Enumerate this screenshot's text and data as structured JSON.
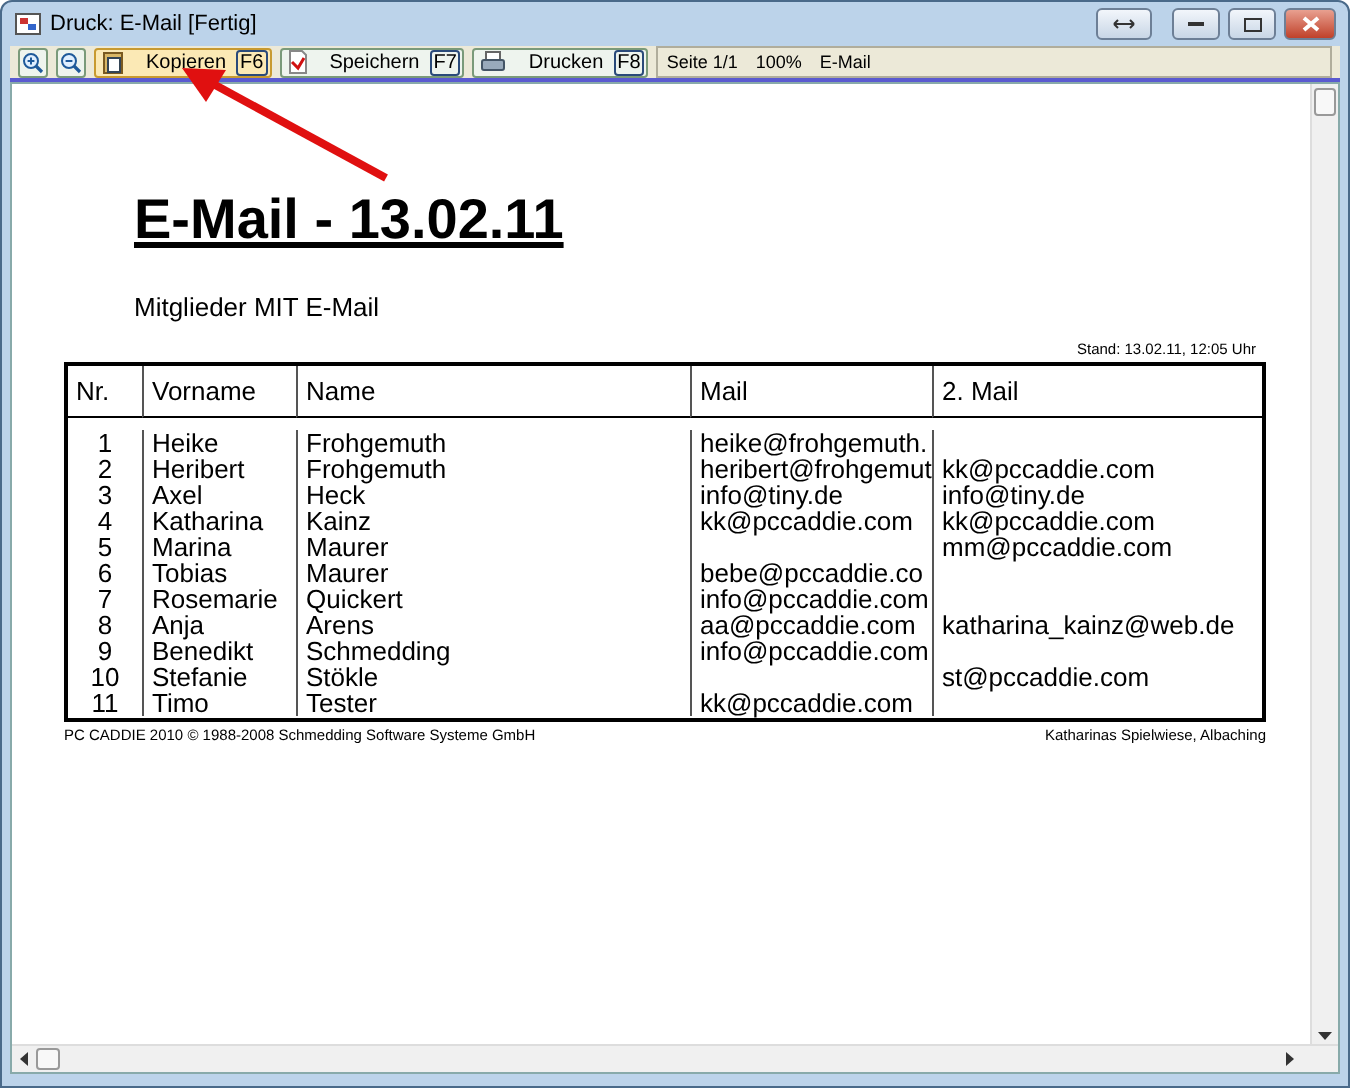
{
  "window": {
    "title": "Druck: E-Mail [Fertig]"
  },
  "toolbar": {
    "buttons": [
      {
        "kind": "copy",
        "label": "Kopieren",
        "key": "F6"
      },
      {
        "kind": "save",
        "label": "Speichern",
        "key": "F7"
      },
      {
        "kind": "print",
        "label": "Drucken",
        "key": "F8"
      }
    ],
    "status": [
      "Seite 1/1",
      "100%",
      "E-Mail"
    ]
  },
  "document": {
    "title": "E-Mail - 13.02.11",
    "subtitle": "Mitglieder MIT E-Mail",
    "stand": "Stand: 13.02.11, 12:05 Uhr",
    "columns": [
      "Nr.",
      "Vorname",
      "Name",
      "Mail",
      "2. Mail"
    ],
    "rows": [
      {
        "nr": "1",
        "first": "Heike",
        "last": "Frohgemuth",
        "mail": "heike@frohgemuth."
      },
      {
        "nr": "2",
        "first": "Heribert",
        "last": "Frohgemuth",
        "mail": "heribert@frohgemut",
        "mail2": "kk@pccaddie.com"
      },
      {
        "nr": "3",
        "first": "Axel",
        "last": "Heck",
        "mail": "info@tiny.de",
        "mail2": "info@tiny.de"
      },
      {
        "nr": "4",
        "first": "Katharina",
        "last": "Kainz",
        "mail": "kk@pccaddie.com",
        "mail2": "kk@pccaddie.com"
      },
      {
        "nr": "5",
        "first": "Marina",
        "last": "Maurer",
        "mail2": "mm@pccaddie.com"
      },
      {
        "nr": "6",
        "first": "Tobias",
        "last": "Maurer",
        "mail": "bebe@pccaddie.co"
      },
      {
        "nr": "7",
        "first": "Rosemarie",
        "last": "Quickert",
        "mail": "info@pccaddie.com"
      },
      {
        "nr": "8",
        "first": "Anja",
        "last": "Arens",
        "mail": "aa@pccaddie.com",
        "mail2": "katharina_kainz@web.de"
      },
      {
        "nr": "9",
        "first": "Benedikt",
        "last": "Schmedding",
        "mail": "info@pccaddie.com"
      },
      {
        "nr": "10",
        "first": "Stefanie",
        "last": "Stökle",
        "mail2": "st@pccaddie.com"
      },
      {
        "nr": "11",
        "first": "Timo",
        "last": "Tester",
        "mail": "kk@pccaddie.com"
      }
    ],
    "footer_left": "PC CADDIE 2010  © 1988-2008 Schmedding Software Systeme GmbH",
    "footer_right": "Katharinas Spielwiese, Albaching"
  }
}
